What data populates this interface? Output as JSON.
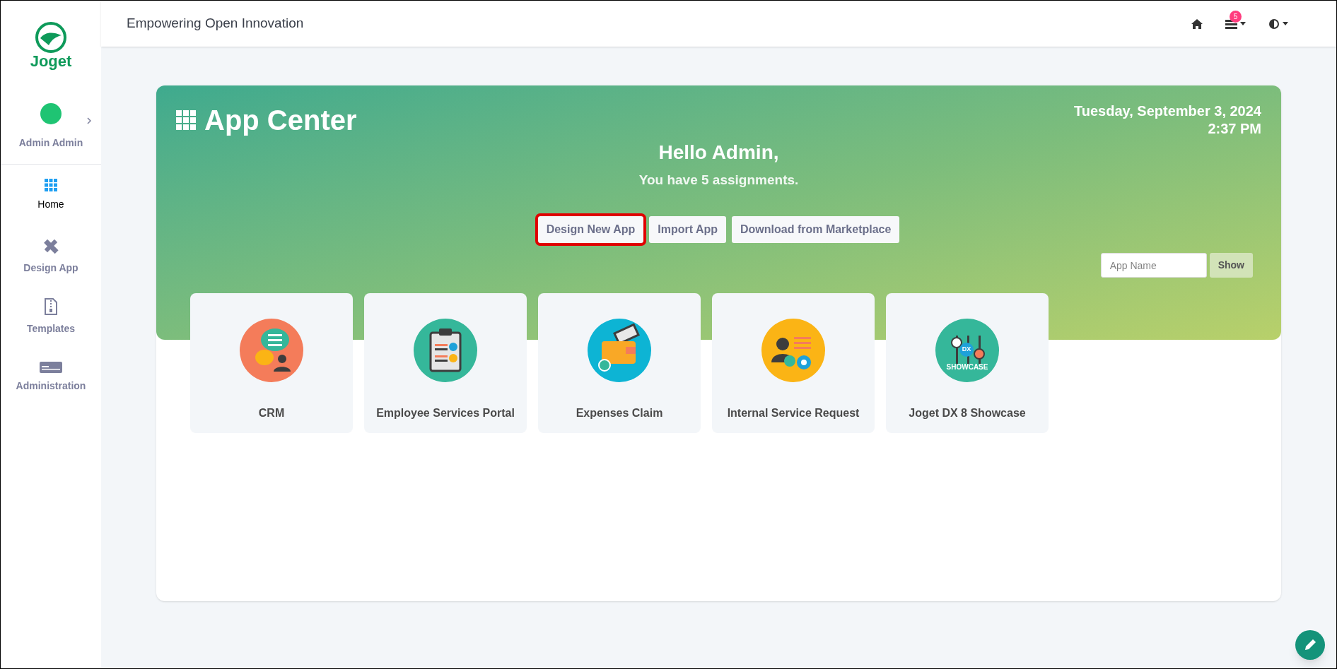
{
  "header": {
    "title": "Empowering Open Innovation",
    "notification_count": "5"
  },
  "sidebar": {
    "logo_text": "Joget",
    "user": "Admin Admin",
    "items": [
      {
        "label": "Home",
        "kind": "home",
        "selected": true
      },
      {
        "label": "Design App",
        "kind": "design",
        "selected": false
      },
      {
        "label": "Templates",
        "kind": "templates",
        "selected": false
      },
      {
        "label": "Administration",
        "kind": "admin",
        "selected": false
      }
    ]
  },
  "banner": {
    "title": "App Center",
    "date": "Tuesday, September 3, 2024",
    "time": "2:37 PM",
    "greeting": "Hello Admin,",
    "subtitle": "You have 5 assignments.",
    "buttons": [
      {
        "label": "Design New App",
        "highlighted": true
      },
      {
        "label": "Import App",
        "highlighted": false
      },
      {
        "label": "Download from Marketplace",
        "highlighted": false
      }
    ],
    "search": {
      "placeholder": "App Name",
      "button": "Show"
    }
  },
  "apps": [
    {
      "name": "CRM",
      "kind": "crm"
    },
    {
      "name": "Employee Services Portal",
      "kind": "clipboard"
    },
    {
      "name": "Expenses Claim",
      "kind": "wallet"
    },
    {
      "name": "Internal Service Request",
      "kind": "service"
    },
    {
      "name": "Joget DX 8 Showcase",
      "kind": "showcase",
      "icon_labels": [
        "DX",
        "SHOWCASE"
      ]
    }
  ]
}
